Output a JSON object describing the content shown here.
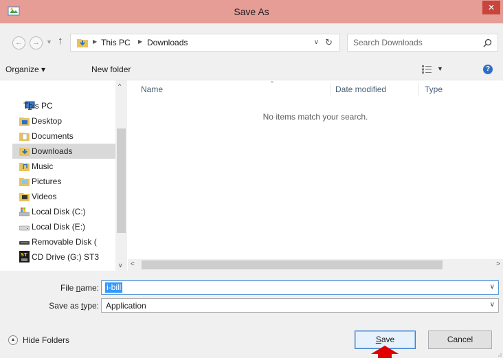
{
  "window": {
    "title": "Save As",
    "close_glyph": "✕"
  },
  "address": {
    "crumbs": [
      "This PC",
      "Downloads"
    ],
    "search_placeholder": "Search Downloads"
  },
  "toolbar": {
    "organize": "Organize ▾",
    "new_folder": "New folder"
  },
  "nav_pane": {
    "items": [
      {
        "label": "This PC",
        "icon": "computer-icon"
      },
      {
        "label": "Desktop",
        "icon": "desktop-folder-icon"
      },
      {
        "label": "Documents",
        "icon": "documents-folder-icon"
      },
      {
        "label": "Downloads",
        "icon": "downloads-folder-icon",
        "selected": true
      },
      {
        "label": "Music",
        "icon": "music-folder-icon"
      },
      {
        "label": "Pictures",
        "icon": "pictures-folder-icon"
      },
      {
        "label": "Videos",
        "icon": "videos-folder-icon"
      },
      {
        "label": "Local Disk (C:)",
        "icon": "system-drive-icon"
      },
      {
        "label": "Local Disk (E:)",
        "icon": "drive-icon"
      },
      {
        "label": "Removable Disk (",
        "icon": "removable-disk-icon"
      },
      {
        "label": "CD Drive (G:) ST3",
        "icon": "cd-drive-icon"
      }
    ]
  },
  "file_list": {
    "columns": [
      "Name",
      "Date modified",
      "Type"
    ],
    "empty_message": "No items match your search."
  },
  "fields": {
    "file_name_label": {
      "pre": "File ",
      "key": "n",
      "post": "ame:"
    },
    "file_name_value": "i-bill",
    "save_type_label": {
      "pre": "Save as ",
      "key": "t",
      "post": "ype:"
    },
    "save_type_value": "Application"
  },
  "bottom": {
    "hide_folders": "Hide Folders",
    "save": {
      "key": "S",
      "rest": "ave"
    },
    "cancel": "Cancel"
  },
  "colors": {
    "titlebar": "#e59d96",
    "close": "#c9443b",
    "selection": "#3399ff",
    "annotation_arrow": "#e00000"
  }
}
